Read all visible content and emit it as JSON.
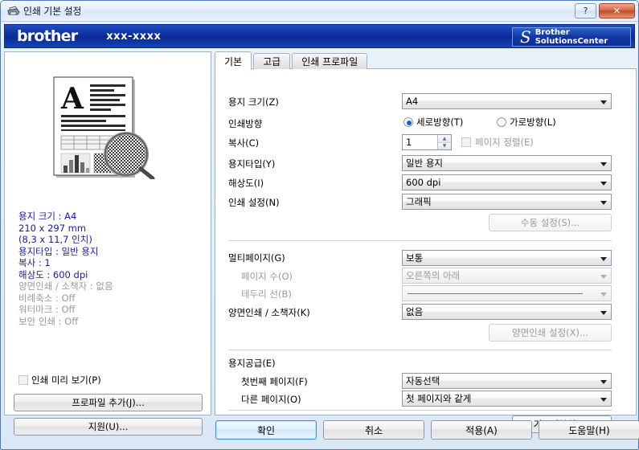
{
  "window": {
    "title": "인쇄 기본 설정",
    "icon": "printer-icon",
    "help_button": "?",
    "close_button": "✕"
  },
  "banner": {
    "brand": "brother",
    "model": "xxx-xxxx",
    "solutions_line1": "Brother",
    "solutions_line2": "SolutionsCenter",
    "logo_glyph": "S",
    "bg_color": "#0b2fa0"
  },
  "preview": {
    "info": [
      {
        "text": "용지 크기 : A4",
        "state": "active"
      },
      {
        "text": "210 x 297 mm",
        "state": "active"
      },
      {
        "text": "(8,3 x 11,7 인치)",
        "state": "active"
      },
      {
        "text": "용지타입 : 일반 용지",
        "state": "active"
      },
      {
        "text": "복사 : 1",
        "state": "active"
      },
      {
        "text": "해상도 : 600 dpi",
        "state": "active"
      },
      {
        "text": "양면인쇄 / 소책자 : 없음",
        "state": "disabled"
      },
      {
        "text": "비례축소 : Off",
        "state": "disabled"
      },
      {
        "text": "워터마크 : Off",
        "state": "disabled"
      },
      {
        "text": "보안 인쇄 : Off",
        "state": "disabled"
      }
    ],
    "active_color": "#1a1aa8",
    "disabled_color": "#9a9a9a"
  },
  "left_controls": {
    "print_preview_label": "인쇄 미리 보기(P)",
    "print_preview_checked": false,
    "add_profile_label": "프로파일 추가(J)...",
    "support_label": "지원(U)..."
  },
  "tabs": [
    {
      "label": "기본",
      "active": true
    },
    {
      "label": "고급",
      "active": false
    },
    {
      "label": "인쇄 프로파일",
      "active": false
    }
  ],
  "basic_tab": {
    "paper_size": {
      "label": "용지 크기(Z)",
      "value": "A4"
    },
    "orientation": {
      "label": "인쇄방향",
      "portrait": "세로방향(T)",
      "landscape": "가로방향(L)",
      "selected": "portrait"
    },
    "copies": {
      "label": "복사(C)",
      "value": "1",
      "collate_label": "페이지 정렬(E)",
      "collate_checked": false,
      "collate_enabled": false
    },
    "media_type": {
      "label": "용지타입(Y)",
      "value": "일반 용지"
    },
    "resolution": {
      "label": "해상도(I)",
      "value": "600 dpi"
    },
    "print_settings": {
      "label": "인쇄 설정(N)",
      "value": "그래픽"
    },
    "manual_settings_button": {
      "label": "수동 설정(S)...",
      "enabled": false
    },
    "multiple_page": {
      "label": "멀티페이지(G)",
      "value": "보통"
    },
    "page_order": {
      "label": "페이지 수(O)",
      "value": "오른쪽의 아래",
      "enabled": false
    },
    "border_line": {
      "label": "테두리 선(B)",
      "value": "",
      "enabled": false
    },
    "duplex": {
      "label": "양면인쇄 / 소책자(K)",
      "value": "없음"
    },
    "duplex_settings_button": {
      "label": "양면인쇄 설정(X)...",
      "enabled": false
    },
    "paper_source": {
      "label": "용지공급(E)",
      "first_page": {
        "label": "첫번째 페이지(F)",
        "value": "자동선택"
      },
      "other_pages": {
        "label": "다른 페이지(O)",
        "value": "첫 페이지와 같게"
      }
    },
    "restore_defaults_button": "기본값복원(D)"
  },
  "dialog_buttons": [
    {
      "label": "확인",
      "default": true
    },
    {
      "label": "취소",
      "default": false
    },
    {
      "label": "적용(A)",
      "default": false
    },
    {
      "label": "도움말(H)",
      "default": false
    }
  ]
}
